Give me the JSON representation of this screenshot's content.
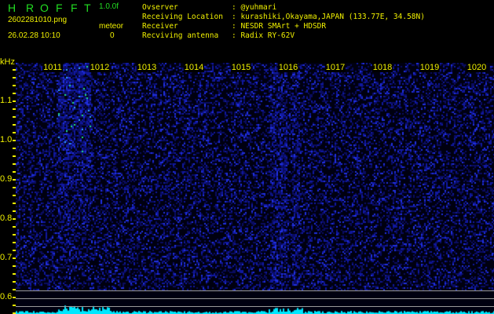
{
  "header": {
    "title_letters": [
      "H",
      "R",
      "O",
      "F",
      "F",
      "T"
    ],
    "version": "1.0.0f",
    "filename": "2602281010.png",
    "datetime": "26.02.28 10:10",
    "meteor_label": "meteor",
    "meteor_count": "0"
  },
  "info": [
    {
      "label": "Ovserver",
      "value": "@yuhmari"
    },
    {
      "label": "Receiving Location",
      "value": "kurashiki,Okayama,JAPAN (133.77E, 34.58N)"
    },
    {
      "label": "Receiver",
      "value": "NESDR SMArt + HDSDR"
    },
    {
      "label": "Recviving antenna",
      "value": "Radix RY-62V"
    }
  ],
  "axis": {
    "y_unit": "kHz",
    "y_labels": [
      "1.1",
      "1.0",
      "0.9",
      "0.8",
      "0.7",
      "0.6"
    ],
    "x_labels": [
      "1011",
      "1012",
      "1013",
      "1014",
      "1015",
      "1016",
      "1017",
      "1018",
      "1019",
      "1020"
    ]
  },
  "colors": {
    "title": "#22dd22",
    "text": "#f0f000",
    "spectrum": "#00ffff",
    "noise": "#0a1a9a"
  }
}
